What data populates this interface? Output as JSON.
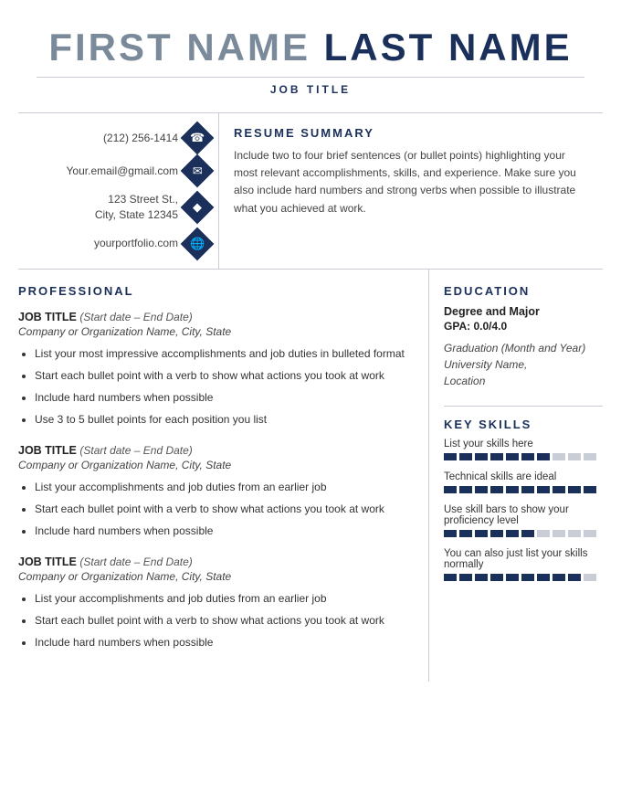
{
  "header": {
    "first_name": "FIRST NAME",
    "last_name": "LAST NAME",
    "job_title": "JOB TITLE"
  },
  "contact": {
    "phone": "(212) 256-1414",
    "email": "Your.email@gmail.com",
    "address_line1": "123 Street St.,",
    "address_line2": "City, State 12345",
    "portfolio": "yourportfolio.com",
    "phone_icon": "📞",
    "email_icon": "✉",
    "address_icon": "📍",
    "web_icon": "🌐"
  },
  "summary": {
    "section_title": "RESUME SUMMARY",
    "text": "Include two to four brief sentences (or bullet points) highlighting your most relevant accomplishments, skills, and experience. Make sure you also include hard numbers and strong verbs when possible to illustrate what you achieved at work."
  },
  "professional": {
    "section_title": "PROFESSIONAL",
    "jobs": [
      {
        "title": "JOB TITLE",
        "dates": "(Start date – End Date)",
        "company": "Company or Organization Name, City, State",
        "bullets": [
          "List your most impressive accomplishments and job duties in bulleted format",
          "Start each bullet point with a verb to show what actions you took at work",
          "Include hard numbers when possible",
          "Use 3 to 5 bullet points for each position you list"
        ]
      },
      {
        "title": "JOB TITLE",
        "dates": "(Start date – End Date)",
        "company": "Company or Organization Name, City, State",
        "bullets": [
          "List your accomplishments and job duties from an earlier job",
          "Start each bullet point with a verb to show what actions you took at work",
          "Include hard numbers when possible"
        ]
      },
      {
        "title": "JOB TITLE",
        "dates": "(Start date – End Date)",
        "company": "Company or Organization Name, City, State",
        "bullets": [
          "List your accomplishments and job duties from an earlier job",
          "Start each bullet point with a verb to show what actions you took at work",
          "Include hard numbers when possible"
        ]
      }
    ]
  },
  "education": {
    "section_title": "EDUCATION",
    "degree": "Degree and Major",
    "gpa": "GPA: 0.0/4.0",
    "grad_date": "Graduation (Month and Year)",
    "university": "University Name,",
    "location": "Location"
  },
  "skills": {
    "section_title": "KEY SKILLS",
    "items": [
      {
        "label": "List your skills here",
        "filled": 7,
        "total": 10
      },
      {
        "label": "Technical skills are ideal",
        "filled": 10,
        "total": 10
      },
      {
        "label": "Use skill bars to show your proficiency level",
        "filled": 6,
        "total": 10
      },
      {
        "label": "You can also just list your skills normally",
        "filled": 9,
        "total": 10
      }
    ]
  }
}
